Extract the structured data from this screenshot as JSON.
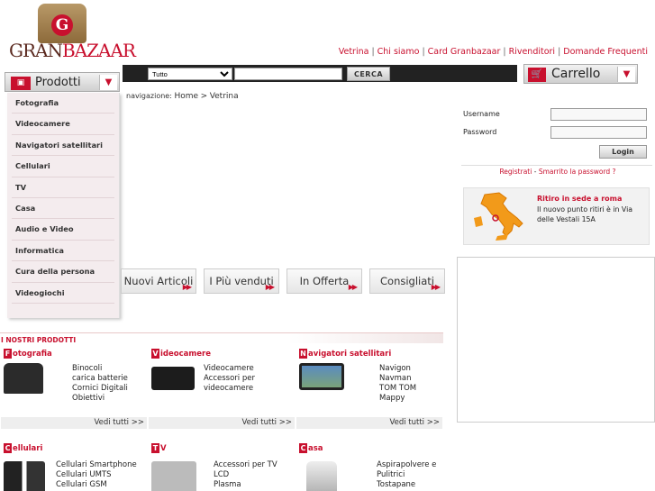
{
  "brand": {
    "logo_letter": "G",
    "name_first": "GRAN",
    "name_second": "BAZAAR"
  },
  "top_nav": [
    "Vetrina",
    "Chi siamo",
    "Card Granbazaar",
    "Rivenditori",
    "Domande Frequenti"
  ],
  "search": {
    "category_value": "Tutto",
    "button_label": "CERCA",
    "value": ""
  },
  "products_menu": {
    "label": "Prodotti",
    "arrow": "▼"
  },
  "cart": {
    "label": "Carrello",
    "arrow": "▼"
  },
  "sidebar": {
    "items": [
      "Fotografia",
      "Videocamere",
      "Navigatori satellitari",
      "Cellulari",
      "TV",
      "Casa",
      "Audio e Video",
      "Informatica",
      "Cura della persona",
      "Videogiochi"
    ]
  },
  "breadcrumb": {
    "prefix": "navigazione:",
    "home": "Home",
    "sep": ">",
    "current": "Vetrina"
  },
  "tabs": [
    "Nuovi Articoli",
    "I Più venduti",
    "In Offerta",
    "Consigliati"
  ],
  "login": {
    "username_label": "Username",
    "password_label": "Password",
    "button_label": "Login",
    "register": "Registrati",
    "dash": " - ",
    "forgot": "Smarrito la password ?"
  },
  "ritiro": {
    "title": "Ritiro in sede a roma",
    "desc": "Il nuovo punto ritiri è in Via delle Vestali 15A"
  },
  "section_title": "I NOSTRI PRODOTTI",
  "categories": [
    {
      "initial": "F",
      "rest": "otografia",
      "links": [
        "Binocoli",
        "carica batterie",
        "Cornici Digitali",
        "Obiettivi"
      ],
      "all": "Vedi tutti >>"
    },
    {
      "initial": "V",
      "rest": "ideocamere",
      "links": [
        "Videocamere",
        "Accessori per",
        "videocamere"
      ],
      "all": "Vedi tutti >>"
    },
    {
      "initial": "N",
      "rest": "avigatori satellitari",
      "links": [
        "Navigon",
        "Navman",
        "TOM TOM",
        "Mappy"
      ],
      "all": "Vedi tutti >>"
    },
    {
      "initial": "C",
      "rest": "ellulari",
      "links": [
        "Cellulari Smartphone",
        "Cellulari UMTS",
        "Cellulari GSM"
      ],
      "all": ""
    },
    {
      "initial": "T",
      "rest": "V",
      "links": [
        "Accessori per TV",
        "LCD",
        "Plasma"
      ],
      "all": ""
    },
    {
      "initial": "C",
      "rest": "asa",
      "links": [
        "Aspirapolvere e",
        "Pulitrici",
        "Tostapane"
      ],
      "all": ""
    }
  ],
  "colors": {
    "accent": "#c8102e",
    "bar": "#222222"
  }
}
